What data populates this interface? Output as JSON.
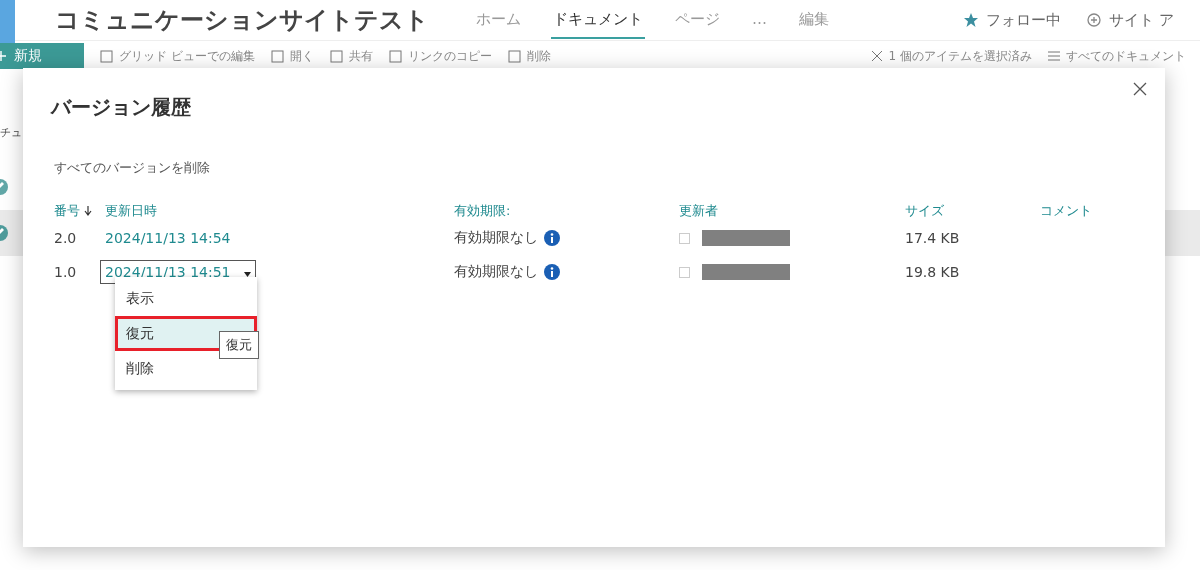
{
  "site": {
    "title": "コミュニケーションサイトテスト",
    "follow": "フォロー中",
    "site_access": "サイト ア",
    "nav": [
      {
        "label": "ホーム",
        "selected": false
      },
      {
        "label": "ドキュメント",
        "selected": true
      },
      {
        "label": "ページ",
        "selected": false
      },
      {
        "label": "…",
        "selected": false
      },
      {
        "label": "編集",
        "selected": false
      }
    ]
  },
  "command_bar": {
    "new_button": "新規",
    "items": [
      {
        "label": "グリッド ビューでの編集"
      },
      {
        "label": "開く"
      },
      {
        "label": "共有"
      },
      {
        "label": "リンクのコピー"
      },
      {
        "label": "削除"
      }
    ],
    "selection": "1 個のアイテムを選択済み",
    "view": "すべてのドキュメント"
  },
  "library": {
    "heading": "チュ",
    "rows": [
      {
        "selected": false
      },
      {
        "selected": true
      }
    ]
  },
  "dialog": {
    "title": "バージョン履歴",
    "delete_all": "すべてのバージョンを削除",
    "columns": [
      {
        "label": "番号",
        "sorted": true
      },
      {
        "label": "更新日時",
        "sorted": false
      },
      {
        "label": "有効期限:",
        "sorted": false
      },
      {
        "label": "更新者",
        "sorted": false
      },
      {
        "label": "サイズ",
        "sorted": false
      },
      {
        "label": "コメント",
        "sorted": false
      }
    ],
    "rows": [
      {
        "number": "2.0",
        "modified": "2024/11/13 14:54",
        "expires": "有効期限なし",
        "size": "17.4 KB",
        "menu_open": false,
        "checked": false
      },
      {
        "number": "1.0",
        "modified": "2024/11/13 14:51",
        "expires": "有効期限なし",
        "size": "19.8 KB",
        "menu_open": true,
        "checked": false
      }
    ],
    "menu": [
      {
        "label": "表示",
        "selected": false
      },
      {
        "label": "復元",
        "selected": true
      },
      {
        "label": "削除",
        "selected": false
      }
    ],
    "tooltip": "復元"
  }
}
